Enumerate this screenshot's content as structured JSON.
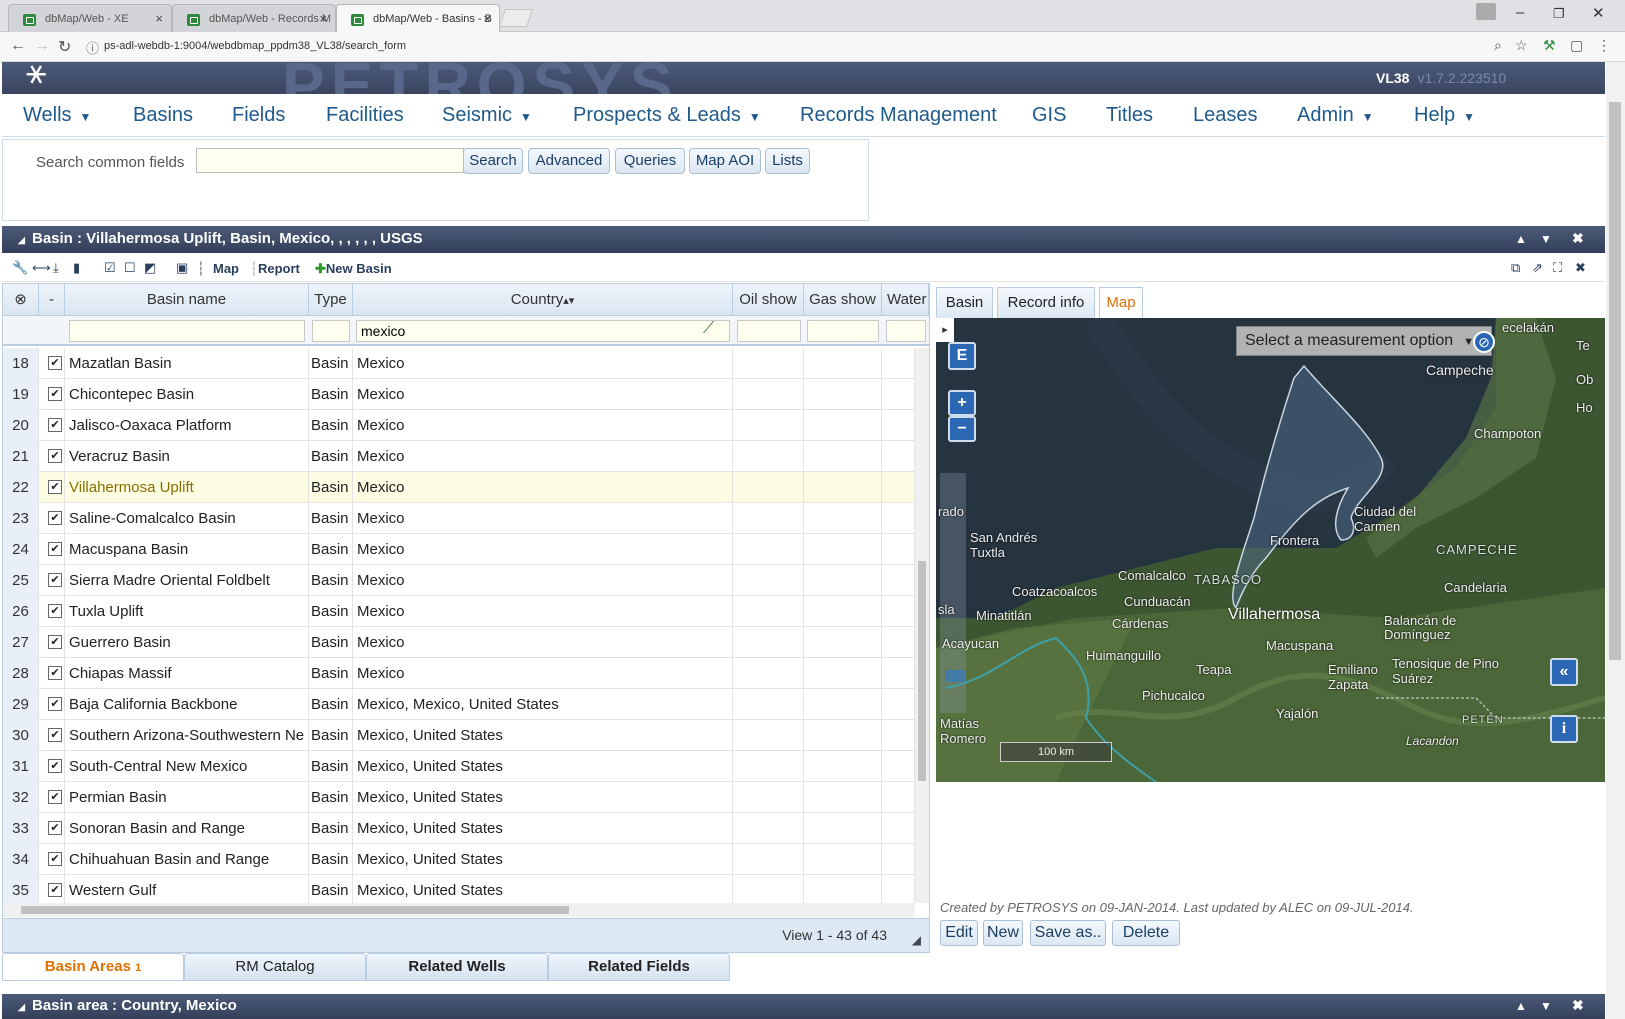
{
  "browser": {
    "tabs": [
      {
        "title": "dbMap/Web - XE"
      },
      {
        "title": "dbMap/Web - Records M"
      },
      {
        "title": "dbMap/Web - Basins - B"
      }
    ],
    "url": "ps-adl-webdb-1:9004/webdbmap_ppdm38_VL38/search_form"
  },
  "app": {
    "version": "VL38",
    "build": "v1.7.2.223510"
  },
  "menu": [
    {
      "label": "Wells",
      "has_caret": true
    },
    {
      "label": "Basins",
      "has_caret": false
    },
    {
      "label": "Fields",
      "has_caret": false
    },
    {
      "label": "Facilities",
      "has_caret": false
    },
    {
      "label": "Seismic",
      "has_caret": true
    },
    {
      "label": "Prospects & Leads",
      "has_caret": true
    },
    {
      "label": "Records Management",
      "has_caret": false
    },
    {
      "label": "GIS",
      "has_caret": false
    },
    {
      "label": "Titles",
      "has_caret": false
    },
    {
      "label": "Leases",
      "has_caret": false
    },
    {
      "label": "Admin",
      "has_caret": true
    },
    {
      "label": "Help",
      "has_caret": true
    }
  ],
  "search": {
    "label": "Search  common fields",
    "value": "",
    "buttons": [
      "Search",
      "Advanced",
      "Queries",
      "Map AOI",
      "Lists"
    ]
  },
  "basin_panel": {
    "title": "Basin : Villahermosa Uplift, Basin, Mexico, , , , , , USGS",
    "toolbar": {
      "map": "Map",
      "report": "Report",
      "new_basin": "New Basin"
    }
  },
  "grid": {
    "columns": [
      "-",
      "Basin name",
      "Type",
      "Country",
      "Oil show",
      "Gas show",
      "Water"
    ],
    "filter": {
      "country": "mexico"
    },
    "selected_row": 22,
    "rows": [
      {
        "num": "18",
        "name": "Mazatlan Basin",
        "type": "Basin",
        "country": "Mexico"
      },
      {
        "num": "19",
        "name": "Chicontepec Basin",
        "type": "Basin",
        "country": "Mexico"
      },
      {
        "num": "20",
        "name": "Jalisco-Oaxaca Platform",
        "type": "Basin",
        "country": "Mexico"
      },
      {
        "num": "21",
        "name": "Veracruz Basin",
        "type": "Basin",
        "country": "Mexico"
      },
      {
        "num": "22",
        "name": "Villahermosa Uplift",
        "type": "Basin",
        "country": "Mexico"
      },
      {
        "num": "23",
        "name": "Saline-Comalcalco Basin",
        "type": "Basin",
        "country": "Mexico"
      },
      {
        "num": "24",
        "name": "Macuspana Basin",
        "type": "Basin",
        "country": "Mexico"
      },
      {
        "num": "25",
        "name": "Sierra Madre Oriental Foldbelt",
        "type": "Basin",
        "country": "Mexico"
      },
      {
        "num": "26",
        "name": "Tuxla Uplift",
        "type": "Basin",
        "country": "Mexico"
      },
      {
        "num": "27",
        "name": "Guerrero Basin",
        "type": "Basin",
        "country": "Mexico"
      },
      {
        "num": "28",
        "name": "Chiapas Massif",
        "type": "Basin",
        "country": "Mexico"
      },
      {
        "num": "29",
        "name": "Baja California Backbone",
        "type": "Basin",
        "country": "Mexico, Mexico, United States"
      },
      {
        "num": "30",
        "name": "Southern Arizona-Southwestern Ne",
        "type": "Basin",
        "country": "Mexico, United States"
      },
      {
        "num": "31",
        "name": "South-Central New Mexico",
        "type": "Basin",
        "country": "Mexico, United States"
      },
      {
        "num": "32",
        "name": "Permian Basin",
        "type": "Basin",
        "country": "Mexico, United States"
      },
      {
        "num": "33",
        "name": "Sonoran Basin and Range",
        "type": "Basin",
        "country": "Mexico, United States"
      },
      {
        "num": "34",
        "name": "Chihuahuan Basin and Range",
        "type": "Basin",
        "country": "Mexico, United States"
      },
      {
        "num": "35",
        "name": "Western Gulf",
        "type": "Basin",
        "country": "Mexico, United States"
      }
    ],
    "pager": "View 1 - 43 of 43"
  },
  "detail_tabs": [
    {
      "label": "Basin",
      "active": false
    },
    {
      "label": "Record info",
      "active": false
    },
    {
      "label": "Map",
      "active": true
    }
  ],
  "map": {
    "measure_placeholder": "Select a measurement option",
    "e_button": "E",
    "zoom_in": "+",
    "zoom_out": "−",
    "collapse_button": "«",
    "info_button": "i",
    "scale": "100 km",
    "labels": {
      "campeche": "Campeche",
      "champoton": "Champoton",
      "ciudad": "Ciudad del Carmen",
      "frontera": "Frontera",
      "san_andres": "San Andrés Tuxtla",
      "coatzacoalcos": "Coatzacoalcos",
      "comalcalco": "Comalcalco",
      "tabasco": "TABASCO",
      "campeche_state": "CAMPECHE",
      "candelaria": "Candelaria",
      "minatitlan": "Minatitlán",
      "cunduacan": "Cunduacán",
      "cardenas": "Cárdenas",
      "villahermosa": "Villahermosa",
      "balancan": "Balancán de Domínguez",
      "acayucan": "Acayucan",
      "macuspana": "Macuspana",
      "huimanguillo": "Huimanguillo",
      "teapa": "Teapa",
      "emiliano": "Emiliano Zapata",
      "tenosique": "Tenosique de Pino Suárez",
      "pichucalco": "Pichucalco",
      "yajalon": "Yajalón",
      "peten": "PETÉN",
      "lacandon": "Lacandon",
      "matias": "Matías Romero",
      "rado": "rado",
      "sla": "sla",
      "celakan": "ecelakán",
      "te": "Te",
      "ob": "Ob",
      "ho": "Ho"
    }
  },
  "record_info": {
    "credit": "Created by PETROSYS on 09-JAN-2014. Last updated by ALEC on 09-JUL-2014."
  },
  "actions": [
    "Edit",
    "New",
    "Save as..",
    "Delete"
  ],
  "bottom_tabs": [
    {
      "label": "Basin Areas",
      "count": "1",
      "active": true
    },
    {
      "label": "RM Catalog",
      "active": false
    },
    {
      "label": "Related Wells",
      "active": false
    },
    {
      "label": "Related Fields",
      "active": false
    }
  ],
  "area_panel": {
    "title": "Basin area : Country, Mexico"
  }
}
